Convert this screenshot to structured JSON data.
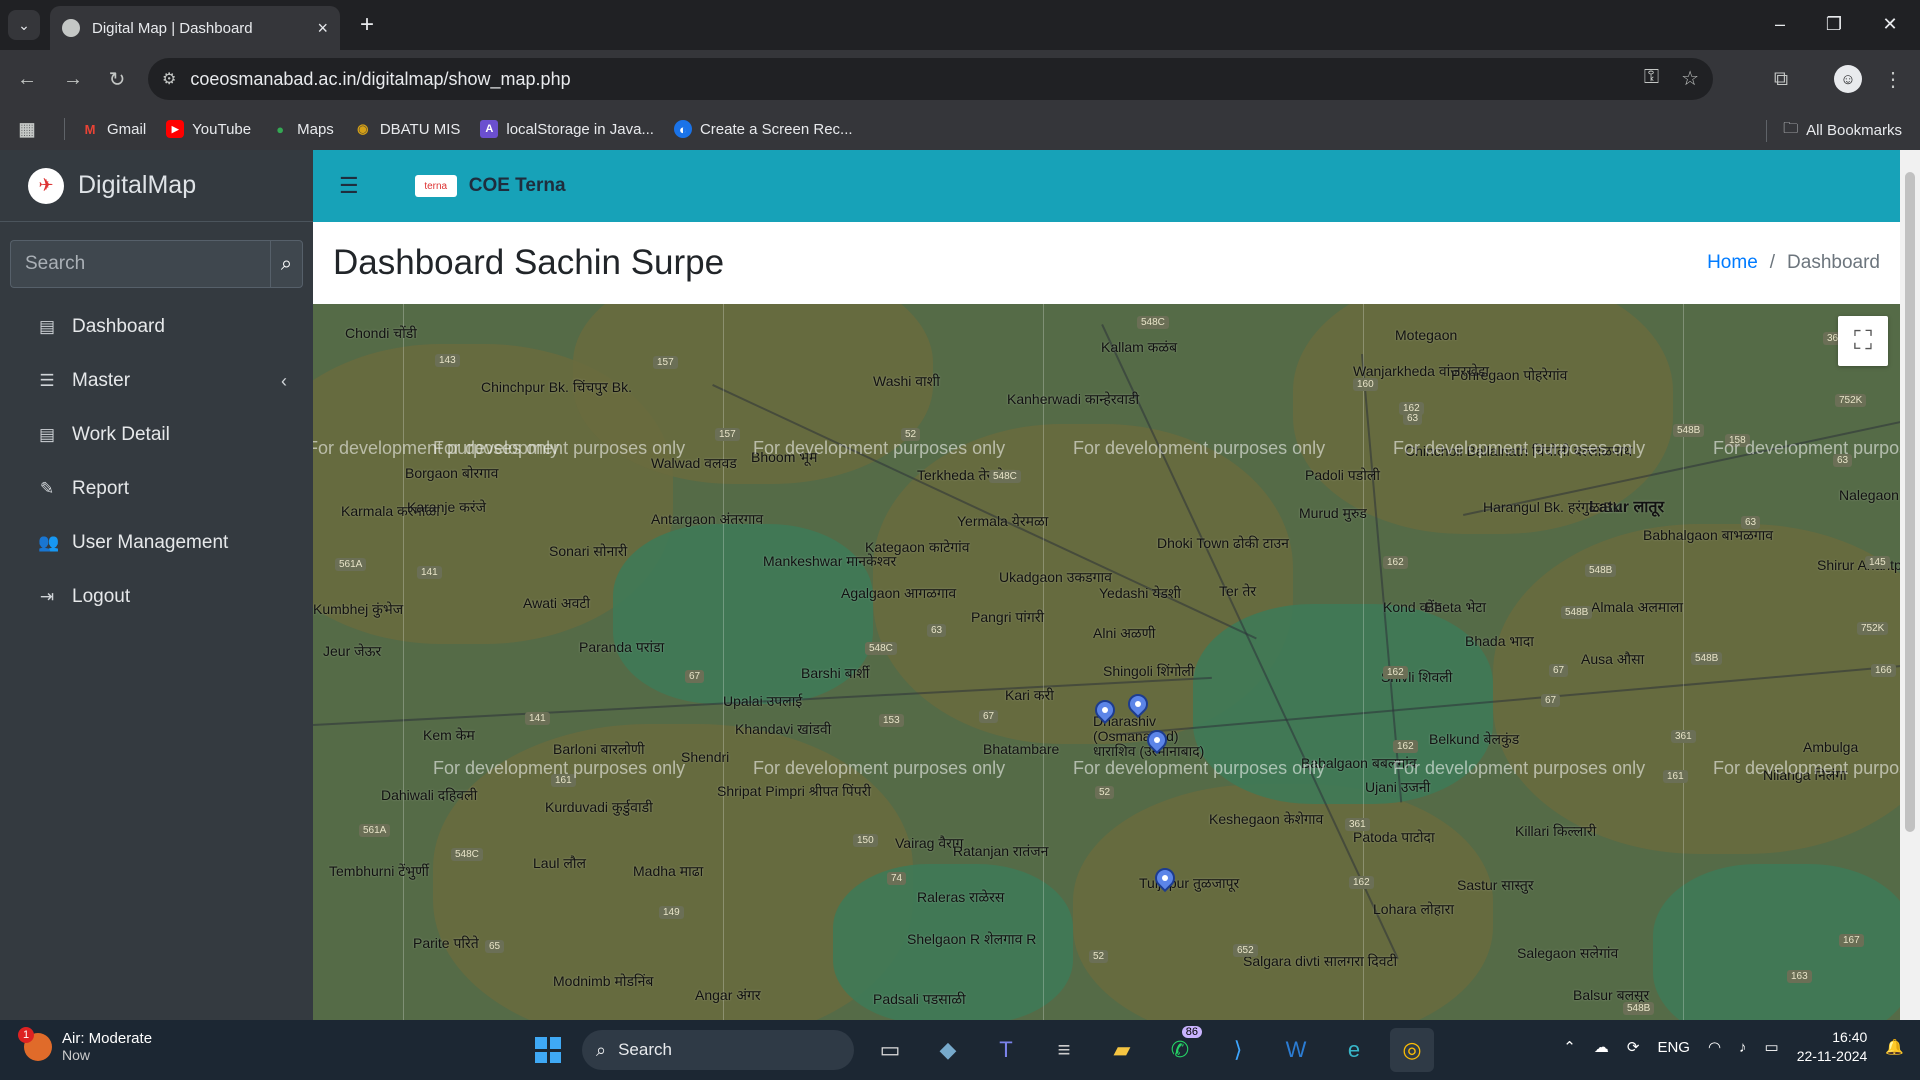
{
  "browser": {
    "tab_title": "Digital Map | Dashboard",
    "url": "coeosmanabad.ac.in/digitalmap/show_map.php",
    "bookmarks": [
      "Gmail",
      "YouTube",
      "Maps",
      "DBATU MIS",
      "localStorage in Java...",
      "Create a Screen Rec..."
    ],
    "all_bookmarks": "All Bookmarks"
  },
  "sidebar": {
    "brand": "DigitalMap",
    "search_placeholder": "Search",
    "items": [
      {
        "label": "Dashboard",
        "icon": "table-icon"
      },
      {
        "label": "Master",
        "icon": "list-icon"
      },
      {
        "label": "Work Detail",
        "icon": "table-icon"
      },
      {
        "label": "Report",
        "icon": "edit-icon"
      },
      {
        "label": "User Management",
        "icon": "users-icon"
      },
      {
        "label": "Logout",
        "icon": "logout-icon"
      }
    ]
  },
  "topbar": {
    "org_logo_text": "terna",
    "org_name": "COE Terna"
  },
  "header": {
    "title": "Dashboard Sachin Surpe",
    "breadcrumb_home": "Home",
    "breadcrumb_sep": "/",
    "breadcrumb_current": "Dashboard"
  },
  "map": {
    "watermark": "For development purposes only",
    "places": [
      "Chondi चोंडी",
      "Chinchpur Bk. चिंचपुर Bk.",
      "Washi वाशी",
      "Kallam कळंब",
      "Kanherwadi कान्हेरवाडी",
      "Motegaon",
      "Wanjarkheda वांजरखेडा",
      "Pohregaon पोहरेगांव",
      "Borgaon बोरगाव",
      "Walwad वलवड",
      "Bhoom भूम",
      "Terkheda तेरखेडा",
      "Padoli पडोली",
      "Chincholi Ballalnath चिंचोली बल्लाळनाथ",
      "Latur लातूर",
      "Karmala करमाळा",
      "Karanje करंजे",
      "Antargaon अंतरगाव",
      "Yermala येरमळा",
      "Murud मुरुड",
      "Harangul Bk. हरंगुळ Bk.",
      "Babhalgaon बाभळगाव",
      "Nalegaon नळेगांव",
      "Sonari सोनारी",
      "Mankeshwar मानकेश्वर",
      "Kategaon काटेगांव",
      "Dhoki Town ढोकी टाउन",
      "Ukadgaon उकडगाव",
      "Yedashi येडशी",
      "Ter तेर",
      "Kumbhej कुंभेज",
      "Awati अवटी",
      "Agalgaon आगळगाव",
      "Pangri पांगरी",
      "Kond कोंड",
      "Bheta भेटा",
      "Almala अलमाला",
      "Shirur Anantpal शिरूर अनंतपाळ",
      "Paranda परांडा",
      "Alni अळणी",
      "Bhada भादा",
      "Ausa औसा",
      "Jeur जेऊर",
      "Barshi बार्शी",
      "Upalai उपलाई",
      "Kari करी",
      "Shingoli शिंगोली",
      "Shivli शिवली",
      "Kem केम",
      "Khandavi खांडवी",
      "Bhatambare",
      "Dharashiv (Osmanabad) धाराशिव (उस्मानाबाद)",
      "Belkund बेलकुंड",
      "Barloni बारलोणी",
      "Shendri",
      "Babalgaon बबलगांव",
      "Ujani उजनी",
      "Ambulga",
      "Nilanga निलंगा",
      "Dahiwali दहिवली",
      "Kurduvadi कुर्डुवाडी",
      "Shripat Pimpri श्रीपत पिंपरी",
      "Keshegaon केशेगाव",
      "Patoda पाटोदा",
      "Killari किल्लारी",
      "Tembhurni टेंभुर्णी",
      "Laul लौल",
      "Madha माढा",
      "Vairag वैराग",
      "Ratanjan रातंजन",
      "Tuljapur तुळजापूर",
      "Sastur सास्तुर",
      "Raleras राळेरस",
      "Lohara लोहारा",
      "Shelgaon R शेलगाव R",
      "Parite परिते",
      "Modnimb मोडनिंब",
      "Angar अंगर",
      "Padsali पडसाळी",
      "Salgara divti सालगरा दिवटी",
      "Salegaon सलेगांव",
      "Balsur बलसूर"
    ],
    "markers": [
      "marker-1",
      "marker-2",
      "marker-3",
      "marker-4"
    ]
  },
  "taskbar": {
    "weather_title": "Air: Moderate",
    "weather_sub": "Now",
    "weather_badge": "1",
    "search": "Search",
    "whatsapp_badge": "86",
    "lang": "ENG",
    "time": "16:40",
    "date": "22-11-2024"
  }
}
